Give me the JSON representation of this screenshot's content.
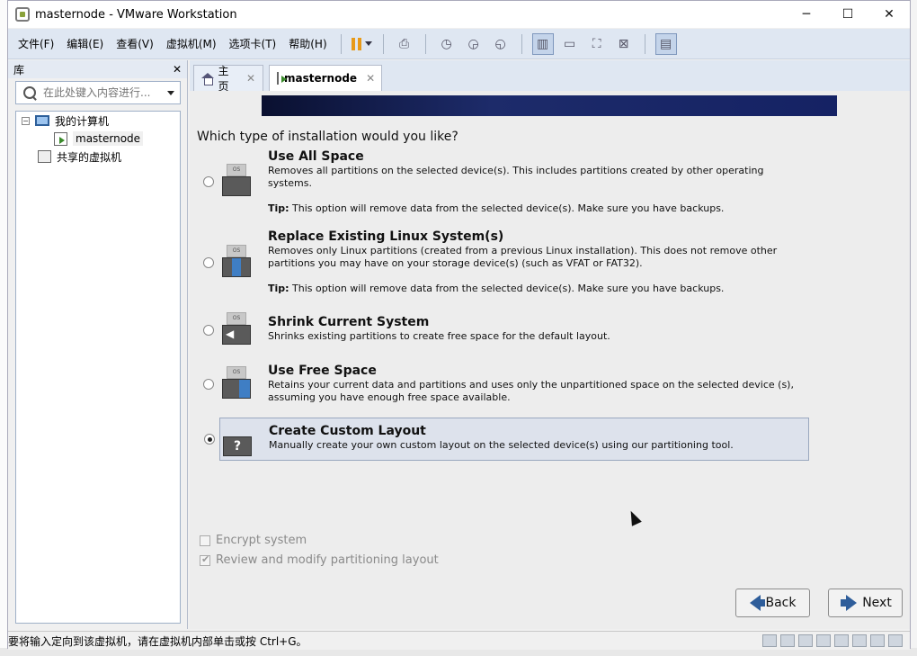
{
  "window": {
    "title": "masternode - VMware Workstation",
    "minimize": "─",
    "maximize": "☐",
    "close": "✕"
  },
  "menu": {
    "items": [
      "文件(F)",
      "编辑(E)",
      "查看(V)",
      "虚拟机(M)",
      "选项卡(T)",
      "帮助(H)"
    ]
  },
  "library": {
    "title": "库",
    "close": "✕",
    "search_placeholder": "在此处键入内容进行...",
    "tree": {
      "my_computer": "我的计算机",
      "vm": "masternode",
      "shared": "共享的虚拟机"
    }
  },
  "tabs": [
    {
      "label": "主页",
      "close": "✕"
    },
    {
      "label": "masternode",
      "close": "✕"
    }
  ],
  "installer": {
    "question": "Which type of installation would you like?",
    "options": [
      {
        "title": "Use All Space",
        "desc": "Removes all partitions on the selected device(s).  This includes partitions created by other operating systems.",
        "tip_label": "Tip:",
        "tip": "This option will remove data from the selected device(s).  Make sure you have backups.",
        "selected": false
      },
      {
        "title": "Replace Existing Linux System(s)",
        "desc": "Removes only Linux partitions (created from a previous Linux installation).  This does not remove other partitions you may have on your storage device(s) (such as VFAT or FAT32).",
        "tip_label": "Tip:",
        "tip": "This option will remove data from the selected device(s).  Make sure you have backups.",
        "selected": false
      },
      {
        "title": "Shrink Current System",
        "desc": "Shrinks existing partitions to create free space for the default layout.",
        "selected": false
      },
      {
        "title": "Use Free Space",
        "desc": "Retains your current data and partitions and uses only the unpartitioned space on the selected device (s), assuming you have enough free space available.",
        "selected": false
      },
      {
        "title": "Create Custom Layout",
        "desc": "Manually create your own custom layout on the selected device(s) using our partitioning tool.",
        "selected": true
      }
    ],
    "os_label": "OS",
    "encrypt_label": "Encrypt system",
    "review_label": "Review and modify partitioning layout",
    "back_label": "Back",
    "next_label": "Next"
  },
  "status": {
    "text": "要将输入定向到该虚拟机，请在虚拟机内部单击或按 Ctrl+G。"
  }
}
